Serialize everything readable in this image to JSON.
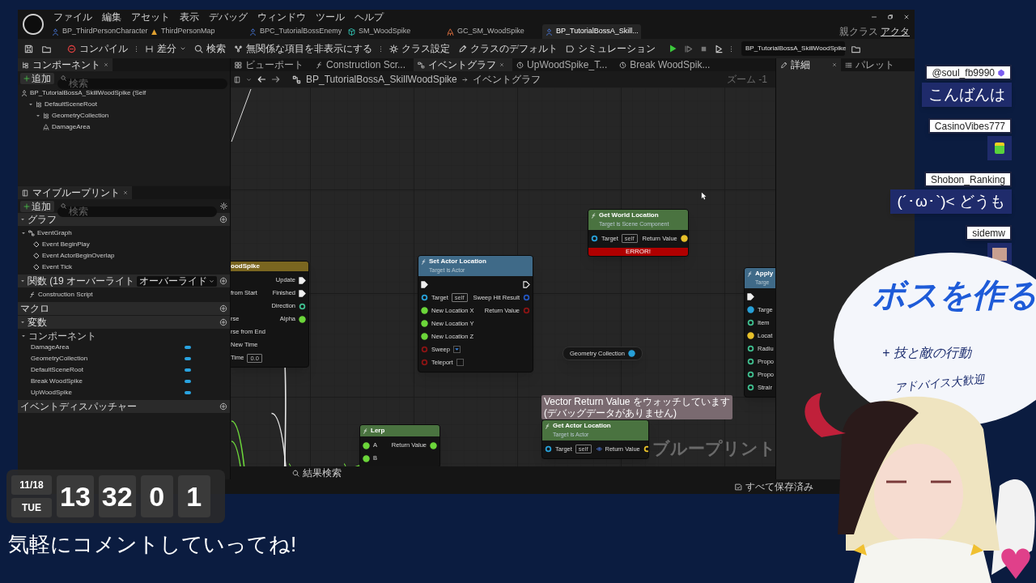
{
  "editor": {
    "menu": [
      "ファイル",
      "編集",
      "アセット",
      "表示",
      "デバッグ",
      "ウィンドウ",
      "ツール",
      "ヘルプ"
    ],
    "parent_class": {
      "label": "親クラス",
      "value": "アクタ"
    },
    "asset_tabs": [
      {
        "label": "BP_ThirdPersonCharacter",
        "selected": false
      },
      {
        "label": "ThirdPersonMap",
        "selected": false
      },
      {
        "label": "BPC_TutorialBossEnemy",
        "selected": false
      },
      {
        "label": "SM_WoodSpike",
        "selected": false
      },
      {
        "label": "GC_SM_WoodSpike",
        "selected": false
      },
      {
        "label": "BP_TutorialBossA_Skill...",
        "selected": true
      }
    ],
    "toolbar": {
      "buttons": [
        "コンパイル",
        "差分",
        "検索",
        "無関係な項目を非表示にする",
        "クラス設定",
        "クラスのデフォルト",
        "シミュレーション"
      ],
      "debug_object": "BP_TutorialBossA_SkillWoodSpike"
    },
    "components": {
      "title": "コンポーネント",
      "add": "追加",
      "search_placeholder": "検索",
      "tree": [
        {
          "label": "BP_TutorialBossA_SkillWoodSpike (Self",
          "children": [
            {
              "label": "DefaultSceneRoot",
              "expanded": true,
              "children": [
                {
                  "label": "GeometryCollection",
                  "expanded": true,
                  "children": [
                    {
                      "label": "DamageArea"
                    }
                  ]
                }
              ]
            }
          ]
        }
      ]
    },
    "my_blueprint": {
      "title": "マイブループリント",
      "add": "追加",
      "search_placeholder": "検索",
      "sections": [
        {
          "label": "グラフ",
          "items": [
            {
              "label": "EventGraph",
              "expanded": true,
              "children": [
                {
                  "label": "Event BeginPlay"
                },
                {
                  "label": "Event ActorBeginOverlap"
                },
                {
                  "label": "Event Tick"
                }
              ]
            }
          ]
        },
        {
          "label": "関数 (19 オーバーライト",
          "override": "オーバーライド",
          "items": [
            {
              "label": "Construction Script"
            }
          ]
        },
        {
          "label": "マクロ"
        },
        {
          "label": "変数",
          "items": [
            {
              "label": "コンポーネント",
              "expanded": true,
              "children": [
                {
                  "label": "DamageArea"
                },
                {
                  "label": "GeometryCollection"
                },
                {
                  "label": "DefaultSceneRoot"
                },
                {
                  "label": "Break WoodSpike"
                },
                {
                  "label": "UpWoodSpike"
                }
              ]
            }
          ]
        },
        {
          "label": "イベントディスパッチャー"
        }
      ]
    },
    "graph": {
      "tabs": [
        {
          "label": "ビューポート",
          "selected": false
        },
        {
          "label": "Construction Scr...",
          "selected": false
        },
        {
          "label": "イベントグラフ",
          "selected": true
        },
        {
          "label": "UpWoodSpike_T...",
          "selected": false
        },
        {
          "label": "Break WoodSpik...",
          "selected": false
        }
      ],
      "breadcrumb": [
        "BP_TutorialBossA_SkillWoodSpike",
        "イベントグラフ"
      ],
      "zoom": "ズーム -1",
      "graph_label": "ブループリント",
      "results_search": "結果検索",
      "nodes": [
        {
          "kind": "timeline",
          "title": "oodSpike",
          "rows": [
            {
              "output": {
                "label": "Update",
                "kind": "exec",
                "connected": true
              }
            },
            {
              "input": {
                "label": "from Start"
              },
              "output": {
                "label": "Finished",
                "kind": "exec",
                "connected": true
              }
            },
            {
              "output": {
                "label": "Direction",
                "kind": "data",
                "color": "#3fbf8f",
                "connected": false
              }
            },
            {
              "input": {
                "label": "rse"
              },
              "output": {
                "label": "Alpha",
                "kind": "data",
                "color": "#6cd63a",
                "connected": true
              }
            },
            {
              "input": {
                "label": "rse from End"
              }
            },
            {
              "input": {
                "label": "New Time"
              }
            },
            {
              "input": {
                "label": "Time",
                "value": "0.0"
              }
            }
          ]
        },
        {
          "kind": "function",
          "pure": false,
          "title": "Set Actor Location",
          "subtitle": "Target is Actor",
          "rows": [
            {
              "input": {
                "kind": "exec",
                "connected": true
              },
              "output": {
                "kind": "exec",
                "connected": false
              }
            },
            {
              "input": {
                "label": "Target",
                "kind": "data",
                "color": "#27a0d8",
                "connected": false,
                "value": "self"
              },
              "output": {
                "label": "Sweep Hit Result",
                "kind": "data",
                "color": "#2456c0",
                "connected": false
              }
            },
            {
              "input": {
                "label": "New Location X",
                "kind": "data",
                "color": "#6cd63a",
                "connected": true
              },
              "output": {
                "label": "Return Value",
                "kind": "data",
                "color": "#8a1414",
                "connected": false
              }
            },
            {
              "input": {
                "label": "New Location Y",
                "kind": "data",
                "color": "#6cd63a",
                "connected": true
              }
            },
            {
              "input": {
                "label": "New Location Z",
                "kind": "data",
                "color": "#6cd63a",
                "connected": true
              }
            },
            {
              "input": {
                "label": "Sweep",
                "kind": "data",
                "color": "#8a1414",
                "connected": false,
                "checked": true
              }
            },
            {
              "input": {
                "label": "Teleport",
                "kind": "data",
                "color": "#8a1414",
                "connected": false,
                "checked": false
              }
            }
          ]
        },
        {
          "kind": "function",
          "pure": true,
          "title": "Get World Location",
          "subtitle": "Target is Scene Component",
          "error": "ERROR!",
          "rows": [
            {
              "input": {
                "label": "Target",
                "kind": "data",
                "color": "#27a0d8",
                "connected": false,
                "value": "self"
              },
              "output": {
                "label": "Return Value",
                "kind": "data",
                "color": "#e8c12a",
                "connected": true
              }
            }
          ]
        },
        {
          "kind": "function",
          "pure": false,
          "title": "Apply",
          "subtitle": "Targe",
          "rows": [
            {
              "input": {
                "kind": "exec",
                "connected": true
              }
            },
            {
              "input": {
                "label": "Targe",
                "kind": "data",
                "color": "#27a0d8",
                "connected": true
              }
            },
            {
              "input": {
                "label": "Item",
                "kind": "data",
                "color": "#3fbf8f",
                "connected": false
              }
            },
            {
              "input": {
                "label": "Locat",
                "kind": "data",
                "color": "#e8c12a",
                "connected": true
              }
            },
            {
              "input": {
                "label": "Radiu",
                "kind": "data",
                "color": "#3fbf8f",
                "connected": false
              }
            },
            {
              "input": {
                "label": "Propo",
                "kind": "data",
                "color": "#3fbf8f",
                "connected": false
              }
            },
            {
              "input": {
                "label": "Propo",
                "kind": "data",
                "color": "#3fbf8f",
                "connected": false
              }
            },
            {
              "input": {
                "label": "Strair",
                "kind": "data",
                "color": "#3fbf8f",
                "connected": false
              }
            }
          ]
        },
        {
          "kind": "variable",
          "rows": [
            {
              "output": {
                "label": "Geometry Collection",
                "kind": "data",
                "color": "#27a0d8",
                "connected": true
              }
            }
          ]
        },
        {
          "kind": "function",
          "pure": true,
          "title": "Lerp",
          "rows": [
            {
              "input": {
                "label": "A",
                "kind": "data",
                "color": "#6cd63a",
                "connected": true
              },
              "output": {
                "label": "Return Value",
                "kind": "data",
                "color": "#6cd63a",
                "connected": true
              }
            },
            {
              "input": {
                "label": "B",
                "kind": "data",
                "color": "#6cd63a",
                "connected": true
              }
            }
          ]
        },
        {
          "kind": "watch",
          "lines": [
            "Vector Return Value をウォッチしています",
            "(デバッグデータがありません)"
          ]
        },
        {
          "kind": "function",
          "pure": true,
          "title": "Get Actor Location",
          "subtitle": "Target is Actor",
          "rows": [
            {
              "input": {
                "label": "Target",
                "kind": "data",
                "color": "#27a0d8",
                "connected": false,
                "value": "self"
              },
              "output": {
                "label": "Return Value",
                "kind": "data",
                "color": "#e8c12a",
                "connected": false
              }
            }
          ]
        }
      ]
    },
    "details": {
      "tabs": [
        {
          "label": "詳細",
          "selected": true
        },
        {
          "label": "パレット",
          "selected": false
        }
      ]
    },
    "status": "すべて保存済み"
  },
  "stream": {
    "clock": {
      "date": "11/18",
      "weekday": "TUE",
      "digits": [
        "13",
        "32",
        "0",
        "1"
      ]
    },
    "caption": "気軽にコメントしていってね!",
    "chat": [
      {
        "user": "@soul_fb9990",
        "badge": true,
        "kind": "text",
        "message": "こんばんは"
      },
      {
        "user": "CasinoVibes777",
        "badge": false,
        "kind": "sticker"
      },
      {
        "user": "Shobon_Ranking",
        "badge": false,
        "kind": "text",
        "message": "(´･ω･`)< どうも"
      },
      {
        "user": "sidemw",
        "badge": false,
        "kind": "photo"
      }
    ],
    "bubble": {
      "title": "ボスを作る",
      "lines": [
        "+ 技と敵の行動",
        "アドバイス大歓迎"
      ]
    }
  }
}
